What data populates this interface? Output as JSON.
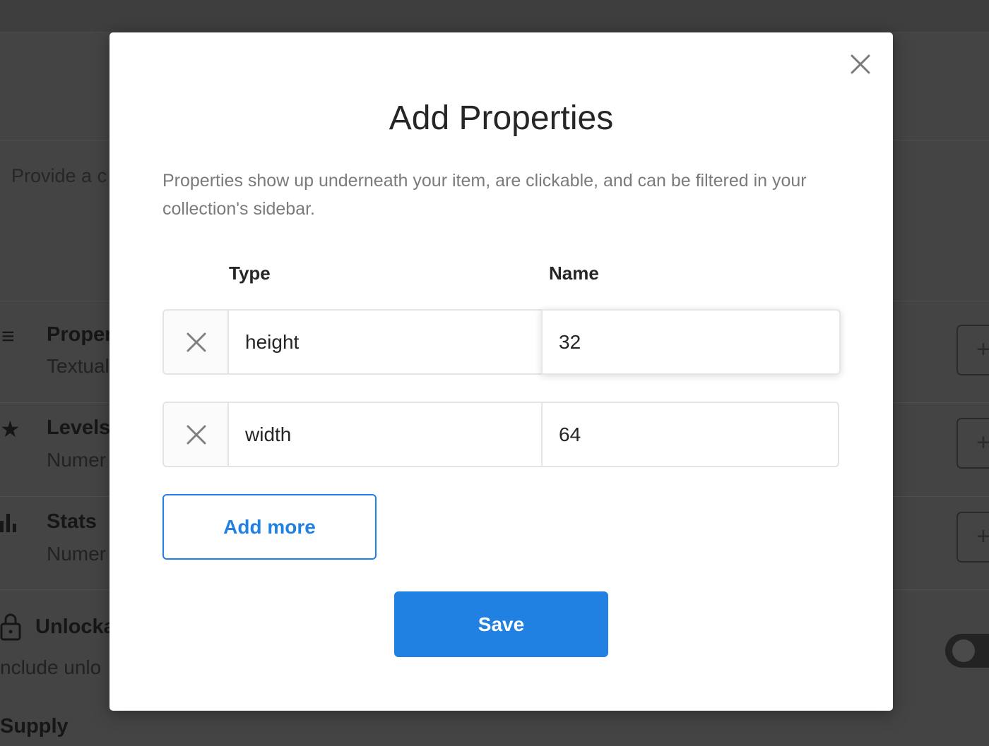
{
  "background": {
    "description_fragment": "Provide a c",
    "sections": [
      {
        "title": "Proper",
        "subtitle": "Textual",
        "icon": "list-icon"
      },
      {
        "title": "Levels",
        "subtitle": "Numer",
        "icon": "star-icon"
      },
      {
        "title": "Stats",
        "subtitle": "Numer",
        "icon": "bar-chart-icon"
      }
    ],
    "unlockable": {
      "title": "Unlocka",
      "subtitle": "nclude unlo",
      "icon": "lock-icon"
    },
    "supply_label": "Supply",
    "add_button_glyph": "+"
  },
  "modal": {
    "title": "Add Properties",
    "description": "Properties show up underneath your item, are clickable, and can be filtered in your collection's sidebar.",
    "columns": {
      "type": "Type",
      "name": "Name"
    },
    "rows": [
      {
        "type": "height",
        "name": "32"
      },
      {
        "type": "width",
        "name": "64"
      }
    ],
    "add_more_label": "Add more",
    "save_label": "Save",
    "close_icon": "close-icon"
  },
  "colors": {
    "accent": "#2081e2",
    "title_text": "#262626",
    "muted_text": "#7b7b7b",
    "border": "#e4e4e4",
    "overlay_bg": "#444444"
  }
}
